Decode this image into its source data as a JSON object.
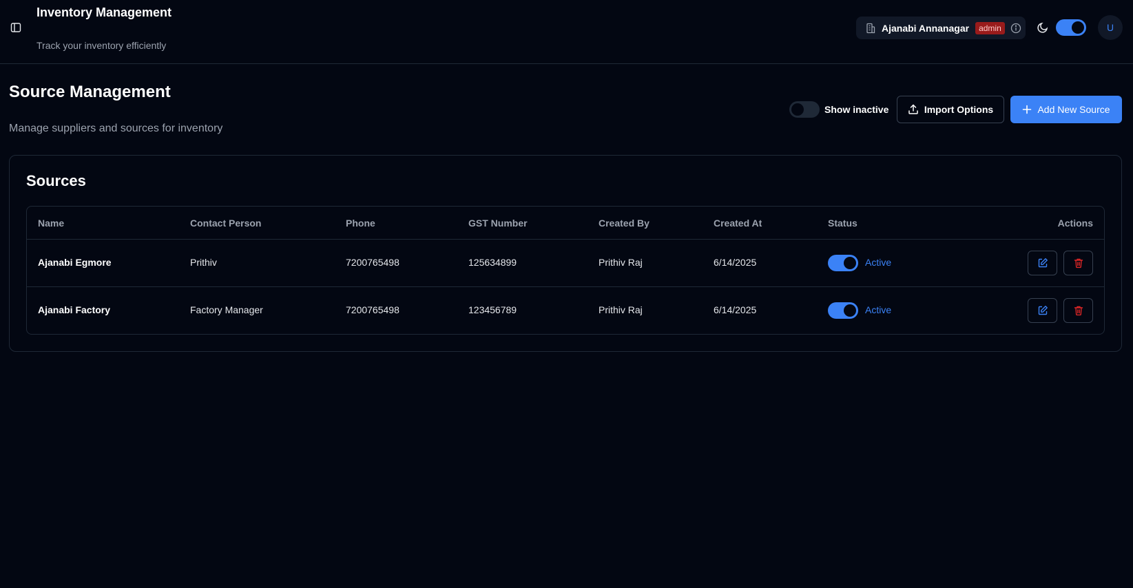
{
  "header": {
    "title": "Inventory Management",
    "subtitle": "Track your inventory efficiently",
    "branch_name": "Ajanabi Annanagar",
    "role_badge": "admin",
    "avatar_initial": "U"
  },
  "page": {
    "title": "Source Management",
    "subtitle": "Manage suppliers and sources for inventory",
    "show_inactive_label": "Show inactive",
    "import_label": "Import Options",
    "add_label": "Add New Source"
  },
  "card": {
    "title": "Sources"
  },
  "table": {
    "columns": [
      "Name",
      "Contact Person",
      "Phone",
      "GST Number",
      "Created By",
      "Created At",
      "Status",
      "Actions"
    ],
    "rows": [
      {
        "name": "Ajanabi Egmore",
        "contact": "Prithiv",
        "phone": "7200765498",
        "gst": "125634899",
        "created_by": "Prithiv Raj",
        "created_at": "6/14/2025",
        "status": "Active"
      },
      {
        "name": "Ajanabi Factory",
        "contact": "Factory Manager",
        "phone": "7200765498",
        "gst": "123456789",
        "created_by": "Prithiv Raj",
        "created_at": "6/14/2025",
        "status": "Active"
      }
    ]
  },
  "colors": {
    "background": "#030712",
    "accent": "#3b82f6",
    "danger": "#dc2626",
    "border": "#1f2937"
  },
  "icons": [
    "sidebar-toggle-icon",
    "building-icon",
    "info-icon",
    "moon-icon",
    "upload-icon",
    "plus-icon",
    "edit-icon",
    "trash-icon"
  ]
}
